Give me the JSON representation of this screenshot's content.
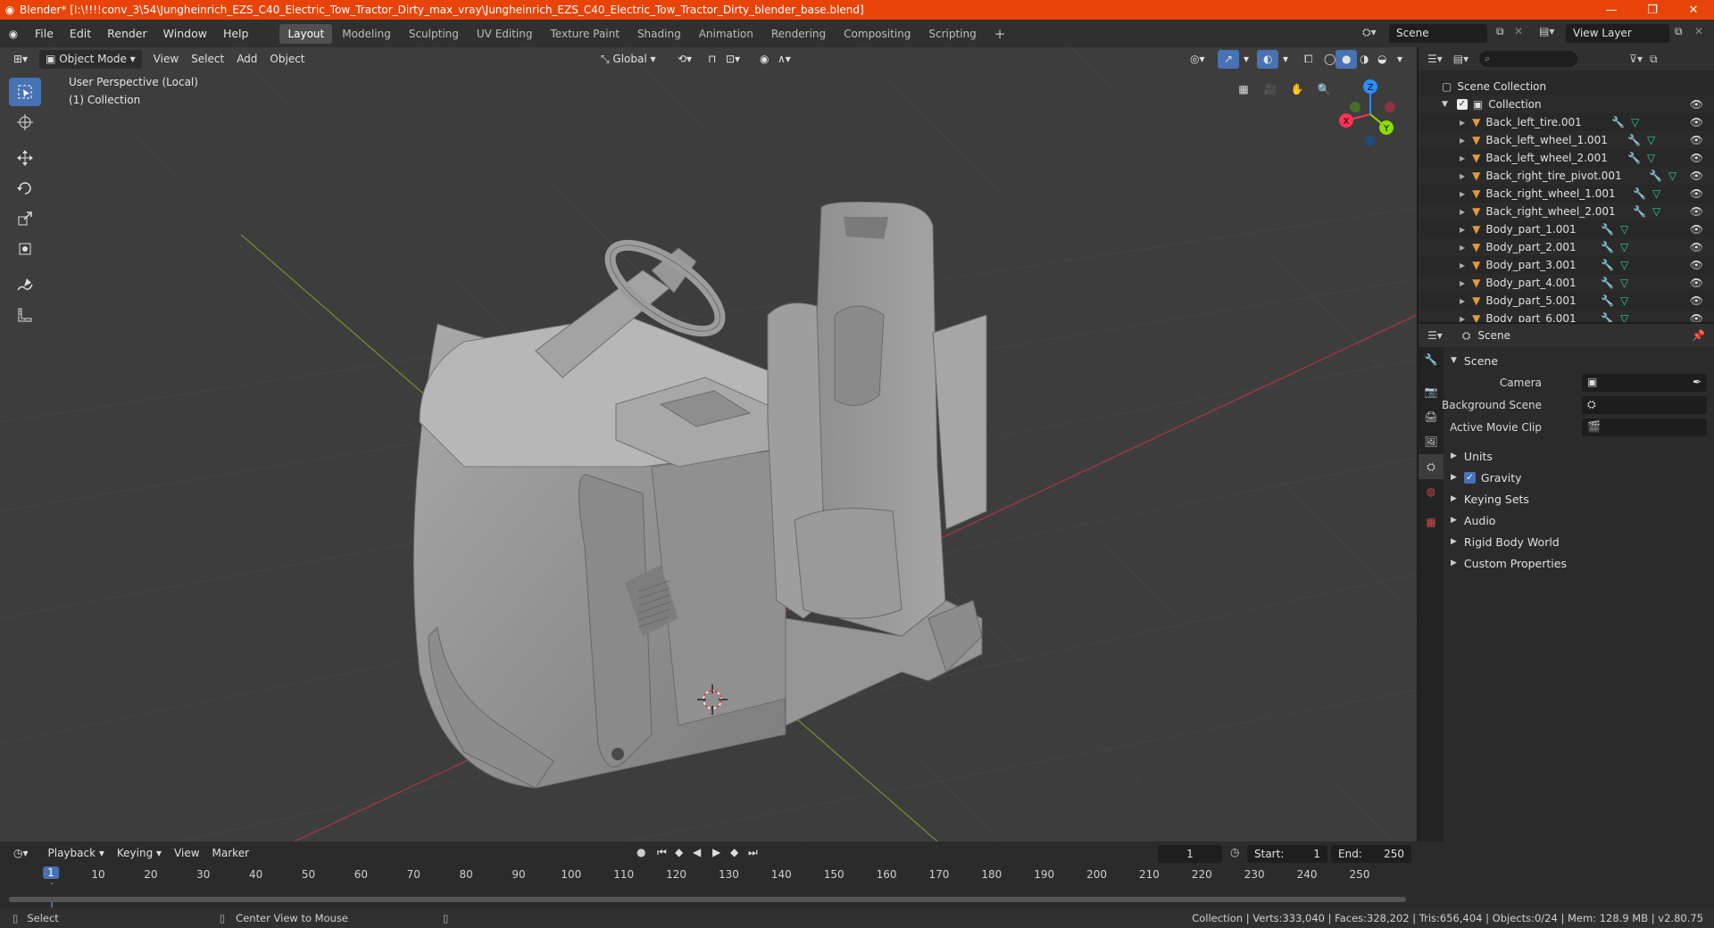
{
  "window": {
    "title": "Blender* [I:\\!!!!conv_3\\54\\Jungheinrich_EZS_C40_Electric_Tow_Tractor_Dirty_max_vray\\Jungheinrich_EZS_C40_Electric_Tow_Tractor_Dirty_blender_base.blend]",
    "minimize": "—",
    "maximize": "❐",
    "close": "✕"
  },
  "menu": [
    "File",
    "Edit",
    "Render",
    "Window",
    "Help"
  ],
  "workspaces": [
    "Layout",
    "Modeling",
    "Sculpting",
    "UV Editing",
    "Texture Paint",
    "Shading",
    "Animation",
    "Rendering",
    "Compositing",
    "Scripting"
  ],
  "active_workspace": "Layout",
  "scene_selector": "Scene",
  "view_layer": "View Layer",
  "viewport": {
    "mode": "Object Mode",
    "menus": [
      "View",
      "Select",
      "Add",
      "Object"
    ],
    "transform_orientation": "Global",
    "perspective_label": "User Perspective (Local)",
    "collection_label": "(1) Collection",
    "gizmo_axes": {
      "x": "X",
      "y": "Y",
      "z": "Z"
    }
  },
  "outliner": {
    "root": "Scene Collection",
    "collection": "Collection",
    "items": [
      "Back_left_tire.001",
      "Back_left_wheel_1.001",
      "Back_left_wheel_2.001",
      "Back_right_tire_pivot.001",
      "Back_right_wheel_1.001",
      "Back_right_wheel_2.001",
      "Body_part_1.001",
      "Body_part_2.001",
      "Body_part_3.001",
      "Body_part_4.001",
      "Body_part_5.001",
      "Body_part_6.001"
    ]
  },
  "properties": {
    "context": "Scene",
    "panel_title": "Scene",
    "camera_label": "Camera",
    "background_scene_label": "Background Scene",
    "active_movie_clip_label": "Active Movie Clip",
    "subpanels": [
      "Units",
      "Gravity",
      "Keying Sets",
      "Audio",
      "Rigid Body World",
      "Custom Properties"
    ],
    "gravity_checked": true
  },
  "timeline": {
    "menus": [
      "Playback",
      "Keying",
      "View",
      "Marker"
    ],
    "current_frame": "1",
    "start_label": "Start:",
    "start": "1",
    "end_label": "End:",
    "end": "250",
    "ruler_labels": [
      "1",
      "10",
      "20",
      "30",
      "40",
      "50",
      "60",
      "70",
      "80",
      "90",
      "100",
      "110",
      "120",
      "130",
      "140",
      "150",
      "160",
      "170",
      "180",
      "190",
      "200",
      "210",
      "220",
      "230",
      "240",
      "250"
    ]
  },
  "statusbar": {
    "select": "Select",
    "center_view": "Center View to Mouse",
    "stats": "Collection | Verts:333,040 | Faces:328,202 | Tris:656,404 | Objects:0/24 | Mem: 128.9 MB | v2.80.75"
  },
  "colors": {
    "title_bar": "#e8440a",
    "accent_blue": "#4772b3",
    "x_axis": "#ff3352",
    "y_axis": "#8bdc00",
    "z_axis": "#2890ff",
    "mesh_icon": "#e39a3b",
    "modifier_icon": "#6fa9ff",
    "data_icon": "#29d49a"
  }
}
